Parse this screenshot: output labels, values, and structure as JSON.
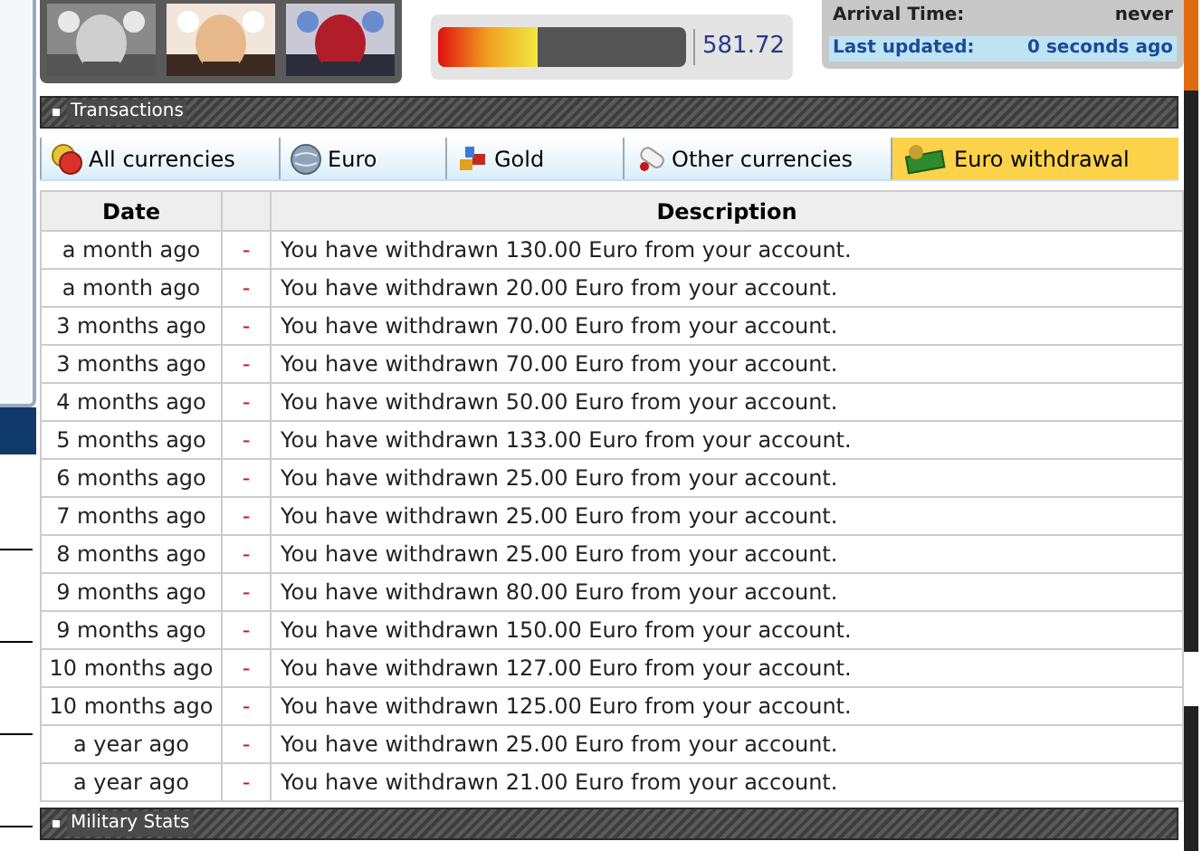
{
  "meter": {
    "level": 0.4,
    "reading": "581.72"
  },
  "info": {
    "rows": [
      {
        "label": "Arrival Time:",
        "value": "never",
        "highlight": false
      },
      {
        "label": "Last updated:",
        "value": "0 seconds ago",
        "highlight": true
      }
    ]
  },
  "transactions": {
    "title": "Transactions"
  },
  "tabs": [
    {
      "label": "All currencies",
      "kind": "coins",
      "selected": false
    },
    {
      "label": "Euro",
      "kind": "globe",
      "selected": false
    },
    {
      "label": "Gold",
      "kind": "gold",
      "selected": false
    },
    {
      "label": "Other currencies",
      "kind": "scroll",
      "selected": false
    },
    {
      "label": "Euro withdrawal",
      "kind": "cash",
      "selected": true
    }
  ],
  "table": {
    "columns": [
      "Date",
      "",
      "Description"
    ],
    "rows": [
      {
        "date": "a month ago",
        "sign": "-",
        "description": "You have withdrawn 130.00 Euro from your account."
      },
      {
        "date": "a month ago",
        "sign": "-",
        "description": "You have withdrawn 20.00 Euro from your account."
      },
      {
        "date": "3 months ago",
        "sign": "-",
        "description": "You have withdrawn 70.00 Euro from your account."
      },
      {
        "date": "3 months ago",
        "sign": "-",
        "description": "You have withdrawn 70.00 Euro from your account."
      },
      {
        "date": "4 months ago",
        "sign": "-",
        "description": "You have withdrawn 50.00 Euro from your account."
      },
      {
        "date": "5 months ago",
        "sign": "-",
        "description": "You have withdrawn 133.00 Euro from your account."
      },
      {
        "date": "6 months ago",
        "sign": "-",
        "description": "You have withdrawn 25.00 Euro from your account."
      },
      {
        "date": "7 months ago",
        "sign": "-",
        "description": "You have withdrawn 25.00 Euro from your account."
      },
      {
        "date": "8 months ago",
        "sign": "-",
        "description": "You have withdrawn 25.00 Euro from your account."
      },
      {
        "date": "9 months ago",
        "sign": "-",
        "description": "You have withdrawn 80.00 Euro from your account."
      },
      {
        "date": "9 months ago",
        "sign": "-",
        "description": "You have withdrawn 150.00 Euro from your account."
      },
      {
        "date": "10 months ago",
        "sign": "-",
        "description": "You have withdrawn 127.00 Euro from your account."
      },
      {
        "date": "10 months ago",
        "sign": "-",
        "description": "You have withdrawn 125.00 Euro from your account."
      },
      {
        "date": "a year ago",
        "sign": "-",
        "description": "You have withdrawn 25.00 Euro from your account."
      },
      {
        "date": "a year ago",
        "sign": "-",
        "description": "You have withdrawn 21.00 Euro from your account."
      }
    ]
  },
  "military": {
    "title": "Military Stats"
  }
}
